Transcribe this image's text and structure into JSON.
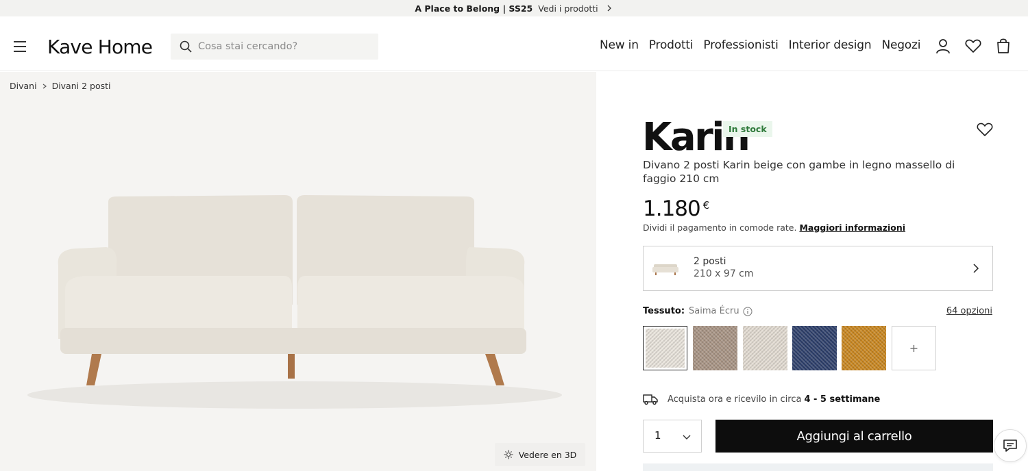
{
  "announcement": {
    "headline": "A Place to Belong | SS25",
    "link": "Vedi i prodotti"
  },
  "header": {
    "logo": "Kave Home",
    "search_placeholder": "Cosa stai cercando?",
    "nav": [
      "New in",
      "Prodotti",
      "Professionisti",
      "Interior design",
      "Negozi"
    ]
  },
  "breadcrumb": [
    "Divani",
    "Divani 2 posti"
  ],
  "gallery": {
    "view3d_label": "Vedere en 3D"
  },
  "product": {
    "name": "Karin",
    "stock_badge": "In stock",
    "description": "Divano 2 posti Karin beige con gambe in legno massello di faggio 210 cm",
    "price": "1.180",
    "currency": "€",
    "installments_text": "Dividi il pagamento in comode rate.",
    "installments_link": "Maggiori informazioni",
    "size": {
      "label": "2 posti",
      "dimensions": "210 x 97 cm"
    },
    "fabric": {
      "label": "Tessuto:",
      "selected": "Saima Écru",
      "options_count": "64 opzioni",
      "swatches": [
        "#e9e4dc",
        "#a89484",
        "#e3dcd2",
        "#2d3f6b",
        "#c9861f"
      ]
    },
    "delivery": {
      "text": "Acquista ora e ricevilo in circa",
      "eta": "4 - 5 settimane"
    },
    "quantity": "1",
    "add_to_cart": "Aggiungi al carrello"
  }
}
